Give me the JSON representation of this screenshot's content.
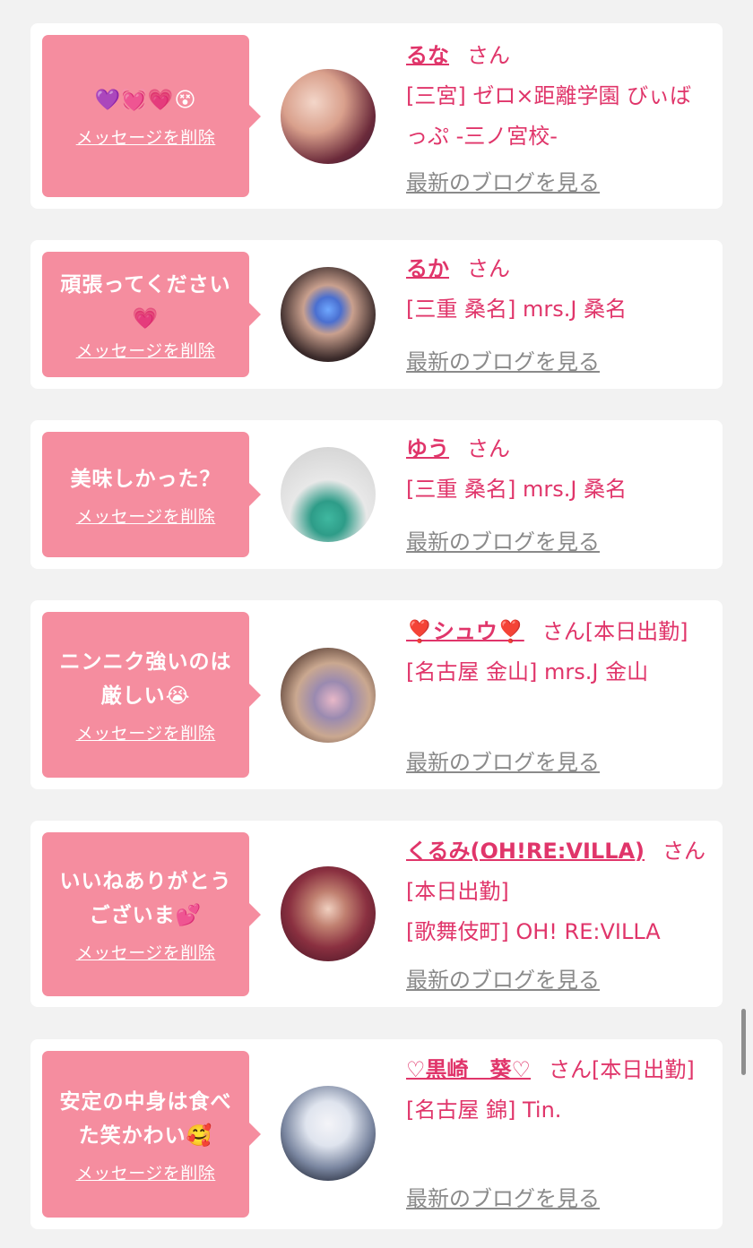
{
  "delete_label": "メッセージを削除",
  "blog_label": "最新のブログを見る",
  "san_label": "さん",
  "colors": {
    "accent": "#e0356a",
    "bubble": "#f58d9f",
    "background": "#f2f2f2",
    "link_gray": "#8a8a8a"
  },
  "cards": [
    {
      "message": "💜💓💗😵",
      "name": "るな",
      "suffix": "",
      "shop": "[三宮] ゼロ×距離学園 びぃばっぷ -三ノ宮校-"
    },
    {
      "message": "頑張ってください💗",
      "name": "るか",
      "suffix": "",
      "shop": "[三重 桑名] mrs.J 桑名"
    },
    {
      "message": "美味しかった？",
      "name": "ゆう",
      "suffix": "",
      "shop": "[三重 桑名] mrs.J 桑名"
    },
    {
      "message": "ニンニク強いのは厳しい😭",
      "name": "❣️シュウ❣️",
      "suffix": "[本日出勤]",
      "shop": "[名古屋 金山] mrs.J 金山"
    },
    {
      "message": "いいねありがとうございま💕",
      "name": "くるみ(OH!RE:VILLA)",
      "suffix": "[本日出勤]",
      "shop": "[歌舞伎町] OH! RE:VILLA"
    },
    {
      "message": "安定の中身は食べた笑かわい🥰",
      "name": "♡黒崎　葵♡",
      "suffix": "[本日出勤]",
      "shop": "[名古屋 錦] Tin."
    }
  ]
}
